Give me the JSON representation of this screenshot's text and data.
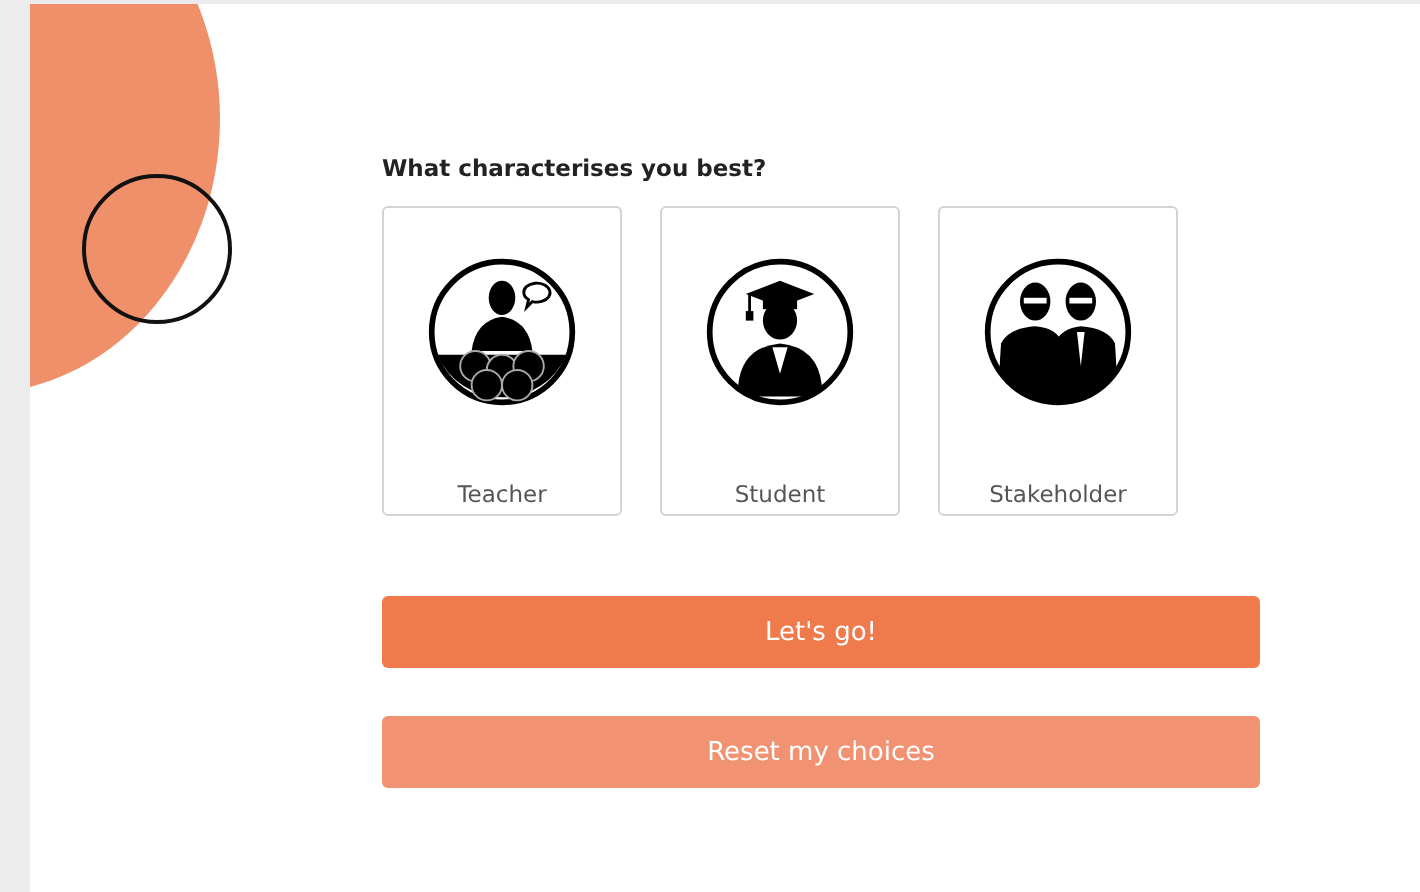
{
  "question": "What characterises you best?",
  "options": [
    {
      "kind": "teacher",
      "label": "Teacher"
    },
    {
      "kind": "student",
      "label": "Student"
    },
    {
      "kind": "stakeholder",
      "label": "Stakeholder"
    }
  ],
  "buttons": [
    {
      "kind": "primary",
      "label": "Let's go!"
    },
    {
      "kind": "secondary",
      "label": "Reset my choices"
    }
  ]
}
